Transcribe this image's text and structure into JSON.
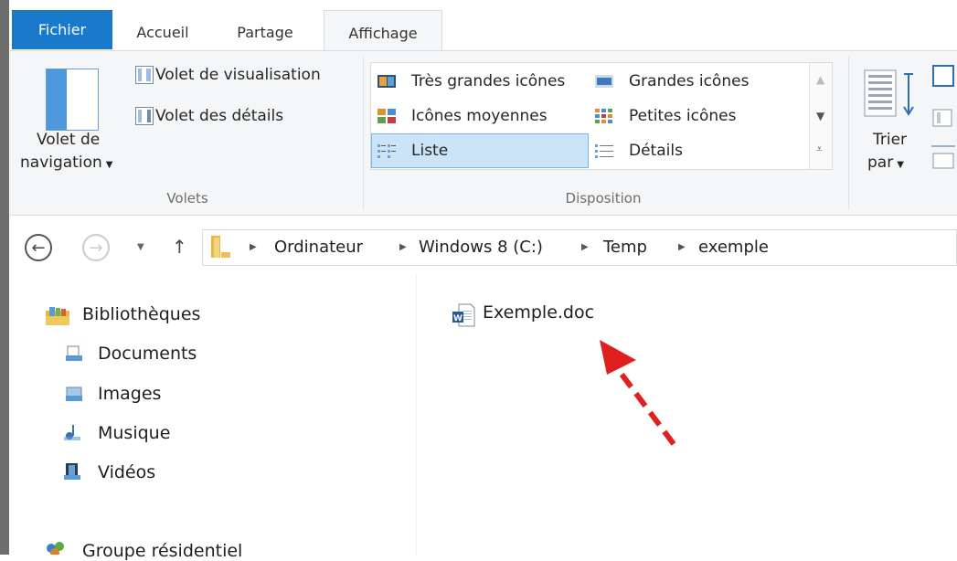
{
  "tabs": {
    "file": "Fichier",
    "home": "Accueil",
    "share": "Partage",
    "view": "Affichage"
  },
  "ribbon": {
    "panes": {
      "nav_pane_line1": "Volet de",
      "nav_pane_line2": "navigation",
      "preview_pane": "Volet de visualisation",
      "details_pane": "Volet des détails",
      "group_label": "Volets"
    },
    "layout": {
      "extra_large_icons": "Très grandes icônes",
      "large_icons": "Grandes icônes",
      "medium_icons": "Icônes moyennes",
      "small_icons": "Petites icônes",
      "list": "Liste",
      "details": "Détails",
      "group_label": "Disposition",
      "selected": "Liste"
    },
    "sort": {
      "line1": "Trier",
      "line2": "par"
    }
  },
  "address": {
    "crumbs": [
      "Ordinateur",
      "Windows 8 (C:)",
      "Temp",
      "exemple"
    ]
  },
  "tree": {
    "libraries": "Bibliothèques",
    "items": [
      "Documents",
      "Images",
      "Musique",
      "Vidéos"
    ],
    "homegroup": "Groupe résidentiel"
  },
  "files": [
    {
      "name": "Exemple.doc",
      "icon": "word-document-icon"
    }
  ],
  "colors": {
    "file_tab": "#1979ca",
    "selection": "#cce4f7",
    "arrow": "#e02020"
  }
}
